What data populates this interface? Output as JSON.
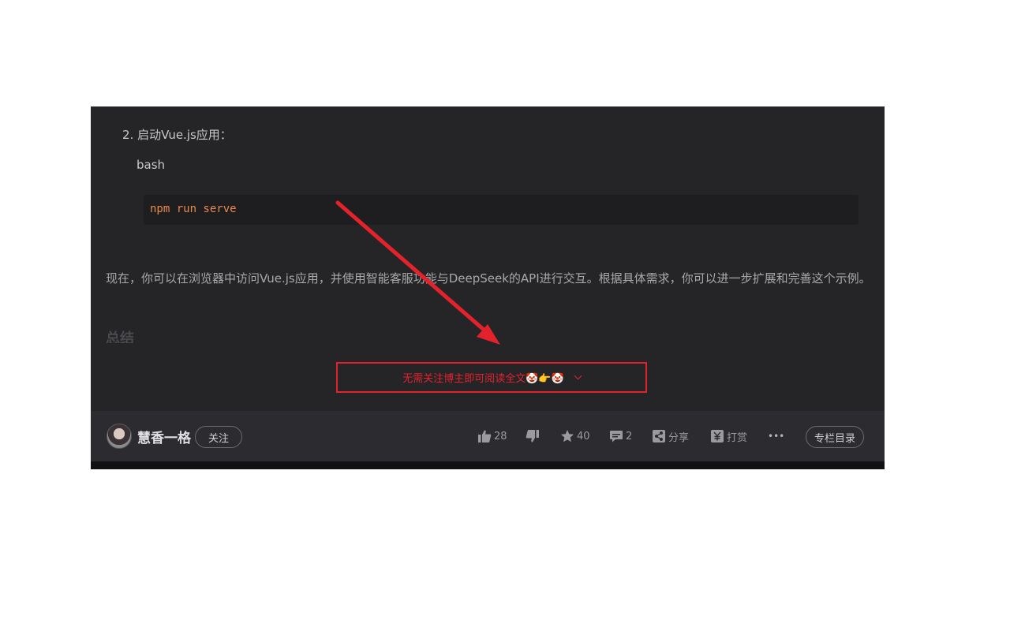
{
  "article": {
    "step_label": "2. 启动Vue.js应用：",
    "code_lang": "bash",
    "code_text": "npm run serve",
    "paragraph": "现在，你可以在浏览器中访问Vue.js应用，并使用智能客服功能与DeepSeek的API进行交互。根据具体需求，你可以进一步扩展和完善这个示例。",
    "heading": "总结"
  },
  "read_more": {
    "label": "无需关注博主即可阅读全文🤡👉🤡"
  },
  "author": {
    "name": "慧香一格",
    "follow_label": "关注"
  },
  "actions": {
    "like_count": "28",
    "favorite_count": "40",
    "comment_count": "2",
    "share_label": "分享",
    "reward_label": "打赏",
    "more_label": "•••",
    "column_label": "专栏目录"
  },
  "colors": {
    "annotation_red": "#e4222c",
    "panel_bg": "#252528",
    "code_keyword": "#e8894f"
  },
  "icons": [
    "thumbs-up-icon",
    "thumbs-down-icon",
    "star-icon",
    "comment-icon",
    "share-icon",
    "reward-icon",
    "more-icon",
    "chevron-down-icon"
  ]
}
